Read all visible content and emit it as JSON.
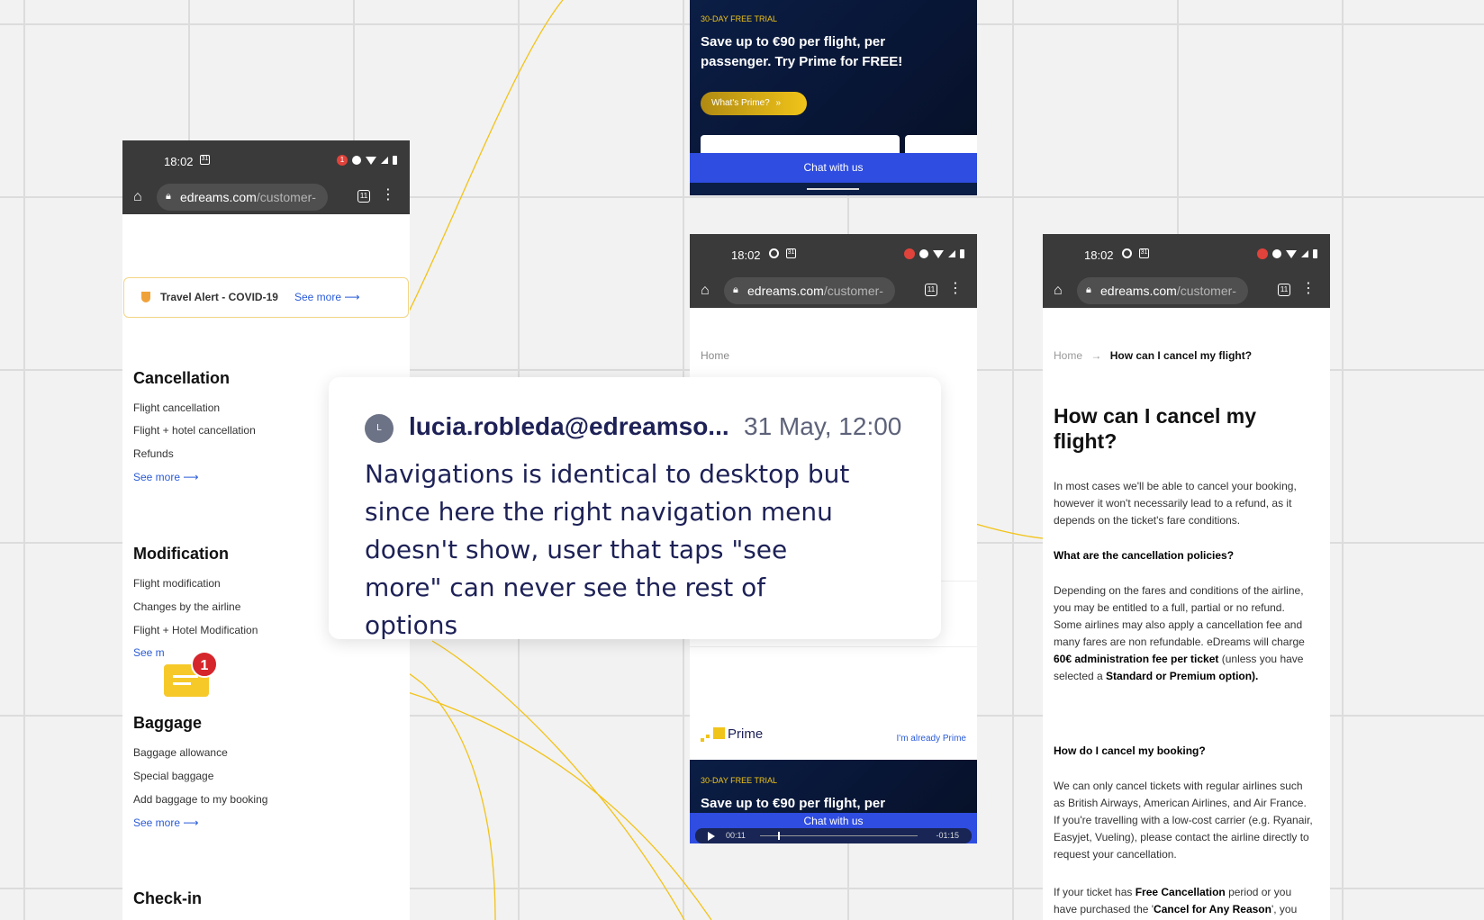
{
  "statusbar": {
    "time": "18:02",
    "tabs_count": "11",
    "notif_count": "1"
  },
  "urlbar": {
    "domain": "edreams.com",
    "path": "/customer-"
  },
  "top_promo": {
    "tag": "30-DAY FREE TRIAL",
    "headline": "Save up to €90 per flight, per passenger. Try Prime for FREE!",
    "cta": "What's Prime?",
    "chat": "Chat with us"
  },
  "left_phone": {
    "alert_text": "Travel Alert - COVID-19",
    "alert_link": "See more",
    "sections": [
      {
        "title": "Cancellation",
        "items": [
          "Flight cancellation",
          "Flight + hotel cancellation",
          "Refunds"
        ],
        "more": "See more"
      },
      {
        "title": "Modification",
        "items": [
          "Flight modification",
          "Changes by the airline",
          "Flight + Hotel Modification"
        ],
        "more": "See m"
      },
      {
        "title": "Baggage",
        "items": [
          "Baggage allowance",
          "Special baggage",
          "Add baggage to my booking"
        ],
        "more": "See more"
      },
      {
        "title": "Check-in"
      }
    ],
    "comment_badge": "1"
  },
  "middle_phone": {
    "breadcrumb": "Home",
    "prime_label": "Prime",
    "already_prime": "I'm already Prime",
    "promo_tag": "30-DAY FREE TRIAL",
    "promo_head": "Save up to €90 per flight, per",
    "chat": "Chat with us",
    "player_start": "00:11",
    "player_end": "-01:15"
  },
  "right_phone": {
    "breadcrumb_home": "Home",
    "breadcrumb_current": "How can I cancel my flight?",
    "title": "How can I cancel my flight?",
    "p1": "In most cases we'll be able to cancel your booking, however it won't necessarily lead to a refund, as it depends on the ticket's fare conditions.",
    "h1": "What are the cancellation policies?",
    "p2a": "Depending on the fares and conditions of the airline, you may be entitled to a full, partial or no refund. Some airlines may also apply a cancellation fee and many fares are non refundable. eDreams will charge ",
    "p2b": "60€ administration fee per ticket",
    "p2c": " (unless you have selected a ",
    "p2d": "Standard or Premium option).",
    "h2": "How do I cancel my booking?",
    "p3": "We can only cancel tickets with regular airlines such as British Airways, American Airlines, and Air France. If you're travelling with a low-cost carrier (e.g. Ryanair, Easyjet, Vueling), please contact the airline directly to request your cancellation.",
    "p4a": "If your ticket has ",
    "p4b": "Free Cancellation",
    "p4c": " period or you have purchased the '",
    "p4d": "Cancel for Any Reason",
    "p4e": "', you"
  },
  "comment": {
    "avatar": "L",
    "author": "lucia.robleda@edreamso...",
    "date": "31 May, 12:00",
    "body": "Navigations is identical to desktop but since here the right navigation menu doesn't show, user that taps \"see more\" can never see the rest of options"
  },
  "colors": {
    "connector": "#f2c318",
    "link": "#2a5bd7",
    "promo_bg": "#0b1e45",
    "chat": "#2f4de0",
    "badge": "#e0433b"
  }
}
